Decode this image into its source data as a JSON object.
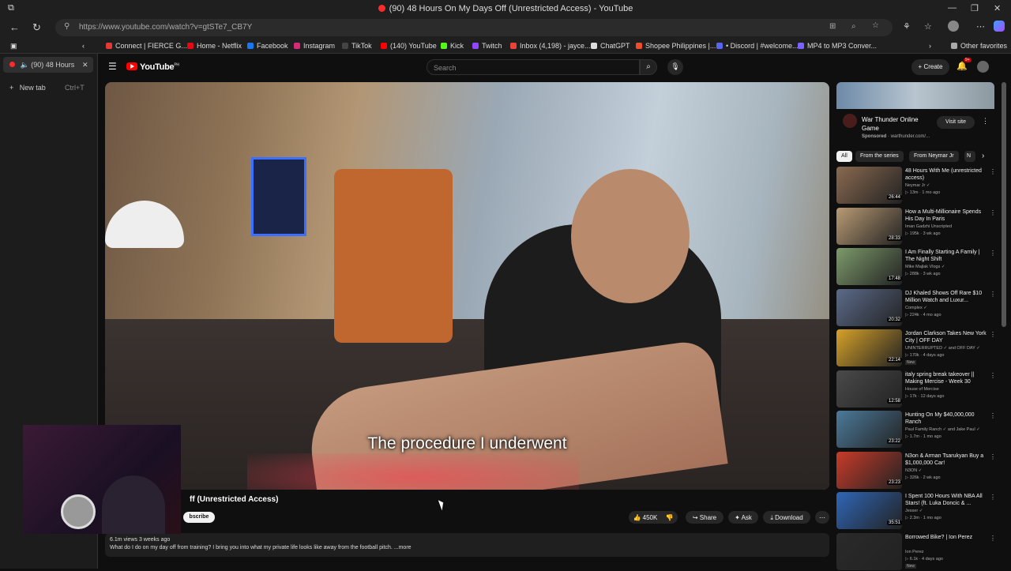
{
  "window": {
    "title": "(90) 48 Hours On My Days Off (Unrestricted Access) - YouTube"
  },
  "browser": {
    "url": "https://www.youtube.com/watch?v=gtSTe7_CB7Y",
    "bookmarks": [
      {
        "label": "Connect | FIERCE G...",
        "color": "#e53935"
      },
      {
        "label": "Home - Netflix",
        "color": "#e50914"
      },
      {
        "label": "Facebook",
        "color": "#1877f2"
      },
      {
        "label": "Instagram",
        "color": "#d62976"
      },
      {
        "label": "TikTok",
        "color": "#222222"
      },
      {
        "label": "(140) YouTube",
        "color": "#ff0000"
      },
      {
        "label": "Kick",
        "color": "#53fc18"
      },
      {
        "label": "Twitch",
        "color": "#9146ff"
      },
      {
        "label": "Inbox (4,198) - jayce...",
        "color": "#ea4335"
      },
      {
        "label": "ChatGPT",
        "color": "#dddddd"
      },
      {
        "label": "Shopee Philippines |...",
        "color": "#ee4d2d"
      },
      {
        "label": "• Discord | #welcome...",
        "color": "#5865f2"
      },
      {
        "label": "MP4 to MP3 Conver...",
        "color": "#7b61ff"
      }
    ],
    "other_favorites": "Other favorites",
    "tabs": [
      {
        "label": "(90) 48 Hours"
      },
      {
        "label": "New tab",
        "shortcut": "Ctrl+T"
      }
    ]
  },
  "youtube": {
    "logo": "YouTube",
    "logo_sup": "PH",
    "search_placeholder": "Search",
    "create_label": "Create",
    "notif_count": "9+",
    "video": {
      "subtitle": "The procedure I underwent",
      "title_partial": "ff (Unrestricted Access)",
      "subscribe_partial": "bscribe",
      "likes": "450K",
      "share": "Share",
      "ask": "Ask",
      "download": "Download",
      "views_date": "6.1m views  3 weeks ago",
      "description": "What do I do on my day off from training? I bring you into what my private life looks like away from the football pitch. ...more"
    },
    "ad": {
      "title": "War Thunder Online Game",
      "sponsored": "Sponsored",
      "domain": "· warthunder.com/...",
      "visit_site": "Visit site"
    },
    "chips": [
      "All",
      "From the series",
      "From Neymar Jr",
      "N"
    ],
    "recommendations": [
      {
        "title": "48 Hours With Me (unrestricted access)",
        "channel": "Neymar Jr ✓",
        "meta": "▷ 13m · 1 mo ago",
        "duration": "26:44",
        "color": "#8a6a50",
        "badge": ""
      },
      {
        "title": "How a Multi-Millionaire Spends His Day In Paris",
        "channel": "Iman Gadzhi Unscripted",
        "meta": "▷ 195k · 3 wk ago",
        "duration": "28:33",
        "color": "#b99b74",
        "badge": ""
      },
      {
        "title": "I Am Finally Starting A Family | The Night Shift",
        "channel": "Mike Majlak Vlogs ✓",
        "meta": "▷ 288k · 3 wk ago",
        "duration": "17:48",
        "color": "#7d9b6b",
        "badge": ""
      },
      {
        "title": "DJ Khaled Shows Off Rare $10 Million Watch and Luxur...",
        "channel": "Complex ✓",
        "meta": "▷ 224k · 4 mo ago",
        "duration": "20:32",
        "color": "#5b6b8a",
        "badge": ""
      },
      {
        "title": "Jordan Clarkson Takes New York City | OFF DAY",
        "channel": "UNINTERRUPTED ✓ and OFF DAY ✓",
        "meta": "▷ 170k · 4 days ago",
        "duration": "22:14",
        "color": "#d7a22a",
        "badge": "New"
      },
      {
        "title": "italy spring break takeover || Making Mercise - Week 30",
        "channel": "House of Mercise",
        "meta": "▷ 17k · 12 days ago",
        "duration": "12:58",
        "color": "#4a4a4a",
        "badge": ""
      },
      {
        "title": "Hunting On My $40,000,000 Ranch",
        "channel": "Paul Family Ranch ✓ and Jake Paul ✓",
        "meta": "▷ 1.7m · 1 mo ago",
        "duration": "23:22",
        "color": "#4c7a9a",
        "badge": ""
      },
      {
        "title": "N3on & Arman Tsarukyan Buy a $1,000,000 Car!",
        "channel": "N3ON ✓",
        "meta": "▷ 326k · 2 wk ago",
        "duration": "23:23",
        "color": "#c93b2a",
        "badge": ""
      },
      {
        "title": "I Spent 100 Hours With NBA All Stars! (ft. Luka Doncic & ...",
        "channel": "Jesser ✓",
        "meta": "▷ 2.3m · 1 mo ago",
        "duration": "35:51",
        "color": "#2f66b7",
        "badge": ""
      },
      {
        "title": "Borrowed Bike? | Ion Perez",
        "channel": "Ion Perez",
        "meta": "▷ 6.1k · 4 days ago",
        "duration": "",
        "color": "#2a2a2a",
        "badge": "New"
      }
    ]
  }
}
